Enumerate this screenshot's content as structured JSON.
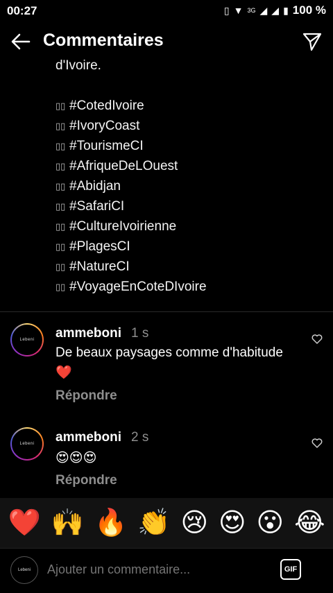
{
  "status": {
    "time": "00:27",
    "network": "3G",
    "battery": "100 %"
  },
  "header": {
    "title": "Commentaires"
  },
  "caption": {
    "top_line": "d'Ivoire.",
    "flag_placeholder": "▯▯",
    "hashtags": [
      "#CotedIvoire",
      "#IvoryCoast",
      "#TourismeCI",
      "#AfriqueDeLOuest",
      "#Abidjan",
      "#SafariCI",
      "#CultureIvoirienne",
      "#PlagesCI",
      "#NatureCI",
      "#VoyageEnCoteDIvoire"
    ]
  },
  "comments": [
    {
      "username": "ammeboni",
      "time": "1 s",
      "text": "De beaux paysages comme d'habitude ❤️",
      "reply": "Répondre",
      "avatar_text": "Lebeni"
    },
    {
      "username": "ammeboni",
      "time": "2 s",
      "text": "😍😍😍",
      "reply": "Répondre",
      "avatar_text": "Lebeni"
    }
  ],
  "reactions": [
    "❤️",
    "🙌",
    "🔥",
    "👏",
    "😢",
    "😍",
    "😮",
    "😂"
  ],
  "composer": {
    "placeholder": "Ajouter un commentaire...",
    "gif_label": "GIF",
    "avatar_text": "Lebeni"
  }
}
